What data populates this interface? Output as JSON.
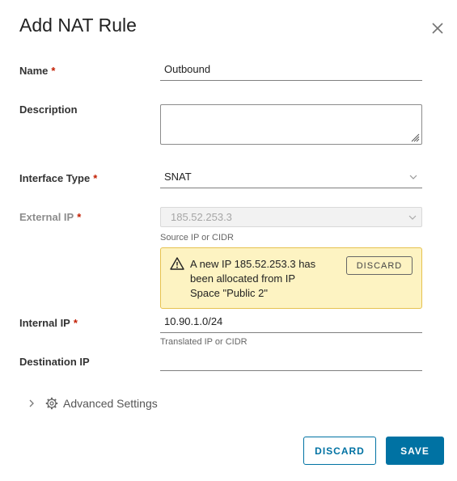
{
  "dialog": {
    "title": "Add NAT Rule",
    "close_icon": "close-icon"
  },
  "form": {
    "required_marker": "*",
    "name": {
      "label": "Name",
      "value": "Outbound"
    },
    "description": {
      "label": "Description",
      "value": ""
    },
    "interface_type": {
      "label": "Interface Type",
      "value": "SNAT"
    },
    "external_ip": {
      "label": "External IP",
      "value": "185.52.253.3",
      "helper": "Source IP or CIDR"
    },
    "internal_ip": {
      "label": "Internal IP",
      "value": "10.90.1.0/24",
      "helper": "Translated IP or CIDR"
    },
    "destination_ip": {
      "label": "Destination IP",
      "value": ""
    }
  },
  "alert": {
    "icon": "warning-icon",
    "message": "A new IP 185.52.253.3 has been allocated from IP Space \"Public 2\"",
    "button_label": "DISCARD",
    "colors": {
      "background": "#fdf3c2",
      "border": "#e6c24f"
    }
  },
  "advanced": {
    "label": "Advanced Settings",
    "icon": "gear-icon"
  },
  "footer": {
    "discard_label": "DISCARD",
    "save_label": "SAVE"
  },
  "colors": {
    "primary": "#0072a3",
    "required": "#c21d00"
  }
}
